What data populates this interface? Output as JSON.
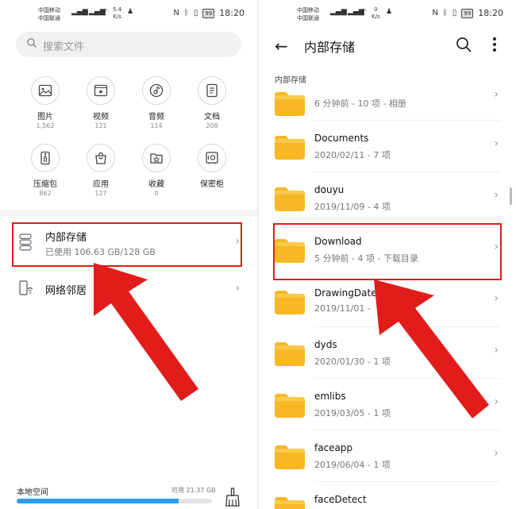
{
  "status": {
    "left_carrier1": "中国移动",
    "left_carrier2": "中国联通",
    "left_net_rate": "5.4",
    "left_net_unit": "K/s",
    "right_carrier1": "中国移动",
    "right_carrier2": "中国联通",
    "right_net_rate": "0",
    "right_net_unit": "K/s",
    "battery": "99",
    "time": "18:20"
  },
  "left": {
    "search_placeholder": "搜索文件",
    "categories": [
      {
        "label": "图片",
        "count": "1,562",
        "icon": "image-icon"
      },
      {
        "label": "视频",
        "count": "121",
        "icon": "video-icon"
      },
      {
        "label": "音频",
        "count": "114",
        "icon": "music-icon"
      },
      {
        "label": "文档",
        "count": "208",
        "icon": "document-icon"
      },
      {
        "label": "压缩包",
        "count": "862",
        "icon": "archive-icon"
      },
      {
        "label": "应用",
        "count": "127",
        "icon": "app-bag-icon"
      },
      {
        "label": "收藏",
        "count": "0",
        "icon": "favorite-icon"
      },
      {
        "label": "保密柜",
        "count": "",
        "icon": "safe-icon"
      }
    ],
    "internal_storage": {
      "title": "内部存储",
      "used": "已使用 106.63 GB/128 GB"
    },
    "network": {
      "title": "网络邻居"
    },
    "bottom": {
      "label": "本地空间",
      "available": "可用 21.37 GB",
      "used_fraction": 0.83
    }
  },
  "right": {
    "title": "内部存储",
    "breadcrumb": "内部存储",
    "folders": [
      {
        "name": "",
        "meta": "6 分钟前 - 10 项 - 相册"
      },
      {
        "name": "Documents",
        "meta": "2020/02/11 - 7 项"
      },
      {
        "name": "douyu",
        "meta": "2019/11/09 - 4 项"
      },
      {
        "name": "Download",
        "meta": "5 分钟前 - 4 项 - 下载目录"
      },
      {
        "name": "DrawingDate",
        "meta": "2019/11/01 -"
      },
      {
        "name": "dyds",
        "meta": "2020/01/30 - 1 项"
      },
      {
        "name": "emlibs",
        "meta": "2019/03/05 - 1 项"
      },
      {
        "name": "faceapp",
        "meta": "2019/06/04 - 1 项"
      },
      {
        "name": "faceDetect",
        "meta": ""
      }
    ]
  },
  "colors": {
    "highlight": "#e21b1b",
    "folder": "#f7b824",
    "folder_tab": "#f9c94a",
    "progress": "#2b9cf0"
  }
}
